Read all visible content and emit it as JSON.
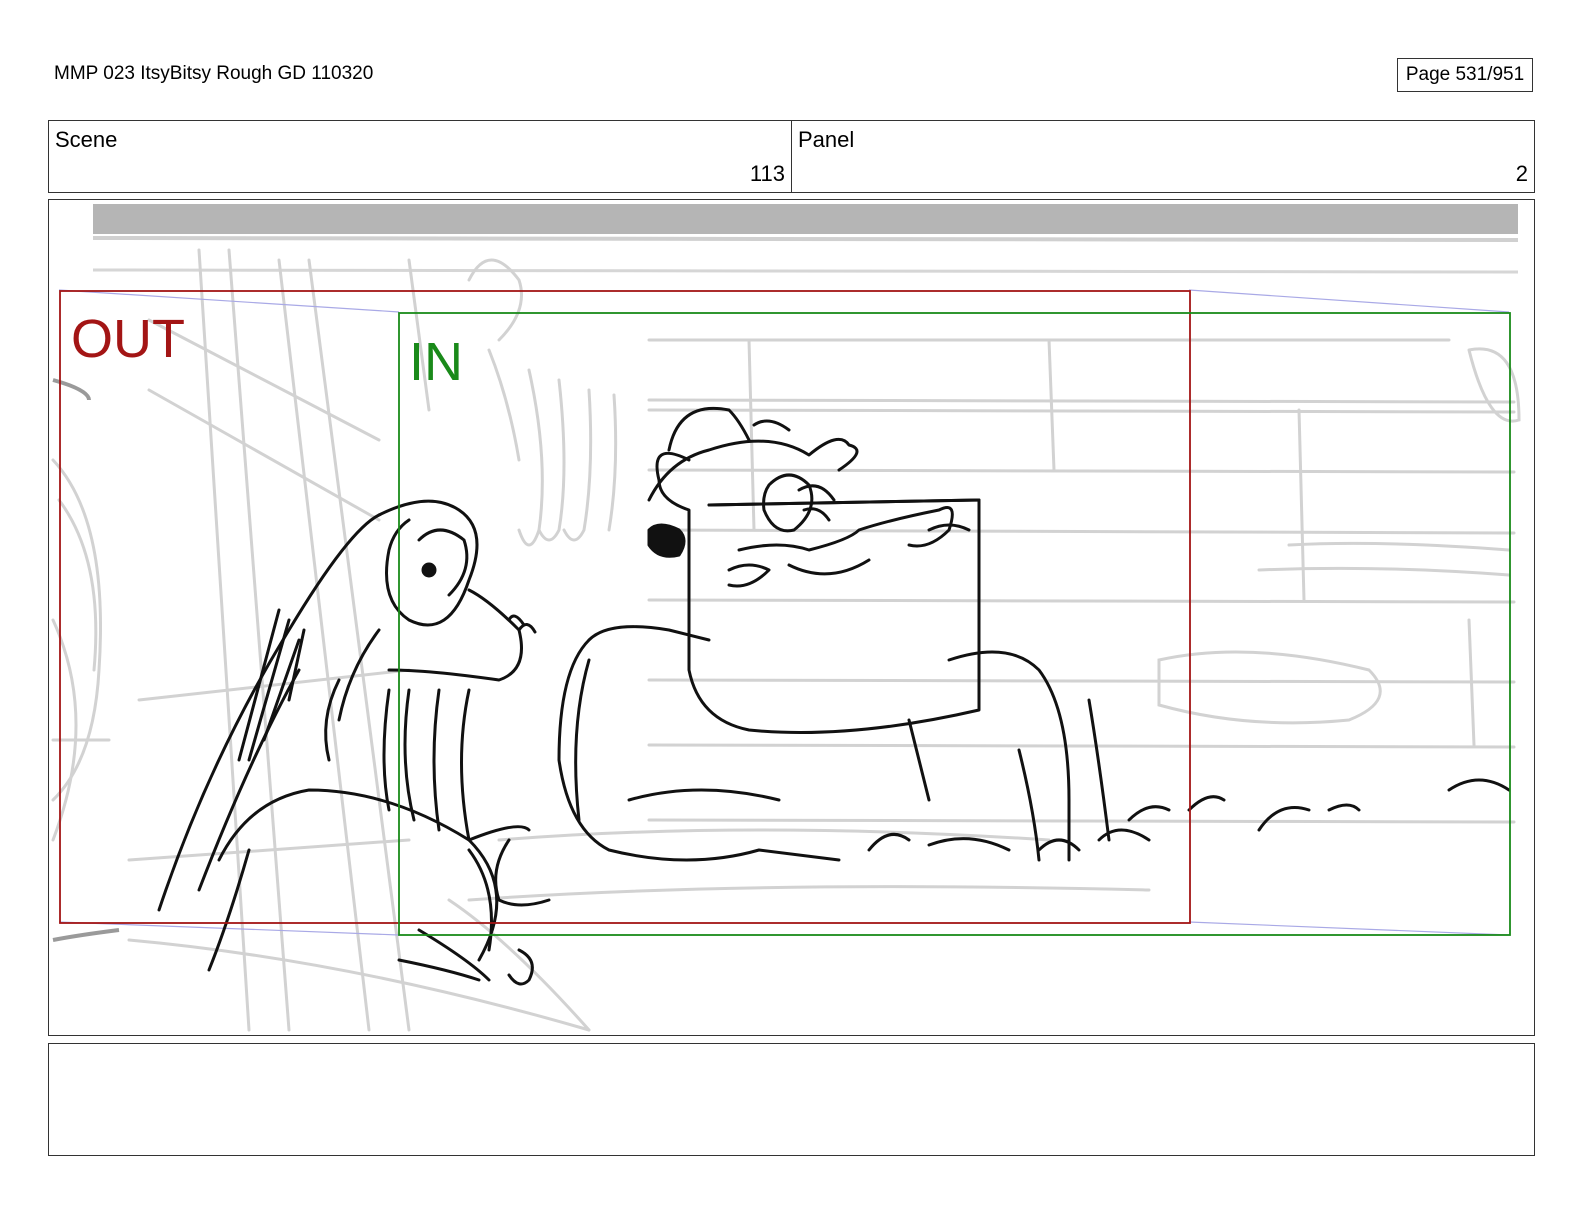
{
  "header": {
    "document_title": "MMP 023 ItsyBitsy Rough GD 110320",
    "page_label": "Page 531/951"
  },
  "scene": {
    "label": "Scene",
    "value": "113"
  },
  "panel": {
    "label": "Panel",
    "value": "2"
  },
  "frames": {
    "out_label": "OUT",
    "in_label": "IN",
    "out_color": "#a31515",
    "in_color": "#1a8a1a"
  },
  "notes": {
    "text": ""
  }
}
